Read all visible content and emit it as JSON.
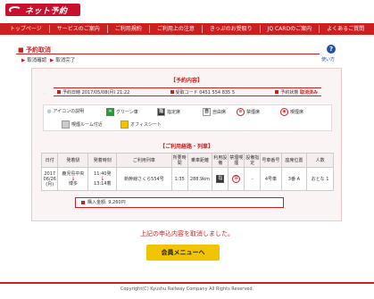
{
  "logo": {
    "text": "ネット予約"
  },
  "nav": [
    "トップページ",
    "サービスのご案内",
    "ご利用規約",
    "ご利用上の注意",
    "きっぷのお受取り",
    "JQ CARDのご案内",
    "よくあるご質問"
  ],
  "page": {
    "title": "■ 予約取消",
    "help_label": "使い方",
    "steps": [
      "取消確認",
      "取消完了"
    ]
  },
  "reservation": {
    "header": "【予約内容】",
    "datetime": "予約日時 2017/05/08(月) 21:22",
    "code": "受取コード 0451 554 835 5",
    "status_label": "予約状態",
    "status_value": "取消済み"
  },
  "legend": {
    "caption": "アイコンの説明",
    "items": [
      "グリーン車",
      "指定席",
      "自由席",
      "禁煙席",
      "喫煙席",
      "喫煙ルーム付近",
      "オフィスシート"
    ]
  },
  "itinerary": {
    "header": "【ご利用経路・列車】",
    "columns": [
      "日付",
      "発着駅",
      "発着時刻",
      "ご利用列車",
      "所要時間",
      "乗車距離",
      "利用設備",
      "禁煙喫煙",
      "設備指定",
      "号車番号",
      "座席位置",
      "人数"
    ],
    "row": {
      "date": "2017 06/26 (月)",
      "from": "鹿児島中央",
      "to": "博多",
      "dep": "11:40発",
      "arr": "13:14着",
      "train": "新幹線さくら554号",
      "duration": "1:35",
      "distance": "288.9km",
      "facility": "指",
      "smoking": "禁",
      "designation": "-",
      "car": "4号車",
      "seat": "3番 A",
      "people": "おとな 1"
    }
  },
  "price": "購入金額: 9,260円",
  "notice": "上記の申込内容を取消しました。",
  "menu_button": "会員メニューへ",
  "copyright": "Copyright(C) Kyushu Railway Company All Rights Reserved."
}
